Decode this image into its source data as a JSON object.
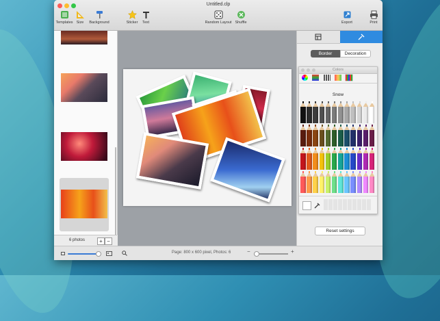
{
  "window": {
    "title": "Untitled.clp"
  },
  "toolbar": {
    "templates": "Templates",
    "size": "Size",
    "background": "Background",
    "sticker": "Sticker",
    "text": "Text",
    "random_layout": "Random Layout",
    "shuffle": "Shuffle",
    "export": "Export",
    "print": "Print"
  },
  "sidebar": {
    "photo_count": "6 photos",
    "add": "+",
    "remove": "−"
  },
  "inspector": {
    "seg_border": "Border",
    "seg_decoration": "Decoration",
    "colors_title": "Colors",
    "color_name": "Snow",
    "reset_button": "Reset settings"
  },
  "bottombar": {
    "page_info": "Page: 800 x 600 pixel, Photos: 6",
    "zoom_plus": "+",
    "zoom_minus": "−"
  },
  "colors": {
    "pencils": [
      "#111111",
      "#2b2b2b",
      "#3d3d3d",
      "#515151",
      "#666666",
      "#7c7c7c",
      "#929292",
      "#a9a9a9",
      "#c0c0c0",
      "#d6d6d6",
      "#eaeaea",
      "#ffffff",
      "#5a1b0f",
      "#7a2c0c",
      "#8b4513",
      "#6b4f1d",
      "#556b2f",
      "#2e5e2a",
      "#1b5e4a",
      "#1c4f6b",
      "#22306b",
      "#3a1f6b",
      "#5a1f6b",
      "#6b1f4a",
      "#c4161c",
      "#e25a1c",
      "#f28e1c",
      "#f4c20d",
      "#9bcf2c",
      "#2aa84a",
      "#17a69a",
      "#1d8fd6",
      "#2649c9",
      "#6a2cc9",
      "#b02ab4",
      "#d8247a",
      "#ff5a5a",
      "#ff9a4a",
      "#ffd24a",
      "#fff36a",
      "#c9f26a",
      "#6fe08a",
      "#5fe6d8",
      "#6cc6ff",
      "#7a8fff",
      "#b08aff",
      "#f08aff",
      "#ff8ac6"
    ]
  }
}
